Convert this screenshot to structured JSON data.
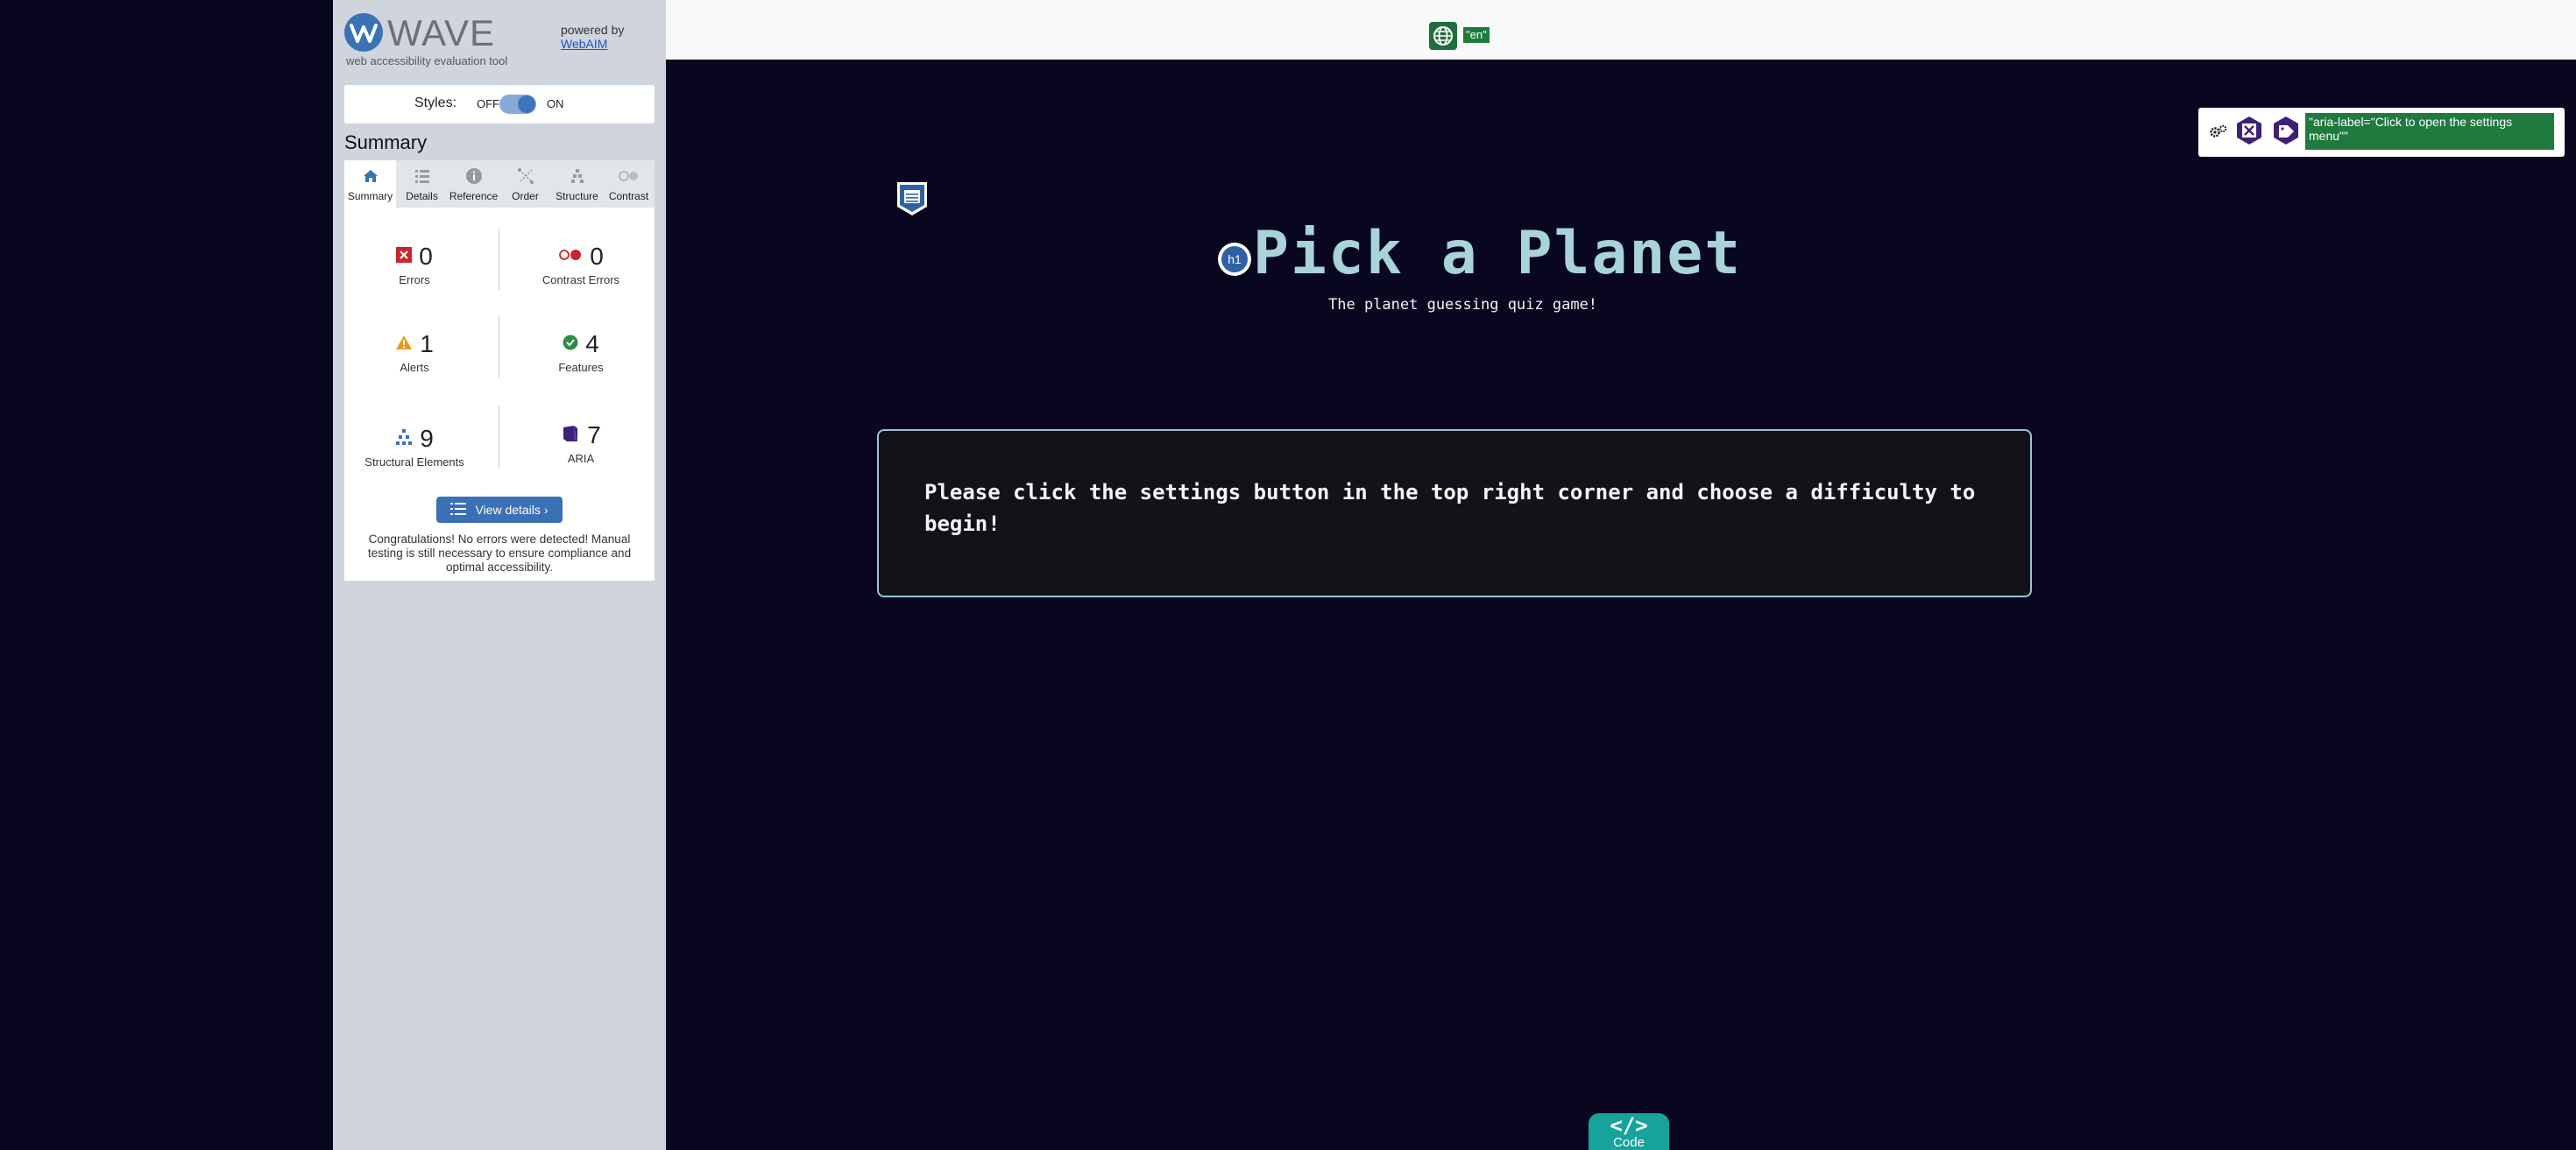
{
  "wave": {
    "logo_text": "WAVE",
    "tagline": "web accessibility evaluation tool",
    "powered_by": "powered by",
    "webaim_link": "WebAIM",
    "styles_label": "Styles:",
    "styles_off": "OFF",
    "styles_on": "ON",
    "summary_heading": "Summary",
    "tabs": [
      {
        "label": "Summary",
        "icon": "home-icon"
      },
      {
        "label": "Details",
        "icon": "list-icon"
      },
      {
        "label": "Reference",
        "icon": "info-icon"
      },
      {
        "label": "Order",
        "icon": "order-icon"
      },
      {
        "label": "Structure",
        "icon": "structure-icon"
      },
      {
        "label": "Contrast",
        "icon": "contrast-icon"
      }
    ],
    "active_tab": "Summary",
    "stats": {
      "errors": {
        "value": "0",
        "label": "Errors"
      },
      "contrast_errors": {
        "value": "0",
        "label": "Contrast Errors"
      },
      "alerts": {
        "value": "1",
        "label": "Alerts"
      },
      "features": {
        "value": "4",
        "label": "Features"
      },
      "structural": {
        "value": "9",
        "label": "Structural Elements"
      },
      "aria": {
        "value": "7",
        "label": "ARIA"
      }
    },
    "view_details_label": "View details ›",
    "congrats": "Congratulations! No errors were detected! Manual testing is still necessary to ensure compliance and optimal accessibility."
  },
  "page": {
    "lang_badge": "\"en\"",
    "aria_label_badge": "\"aria-label=\"Click to open the settings menu\"\"",
    "h1_badge": "h1",
    "title": "Pick a Planet",
    "subtitle": "The planet guessing quiz game!",
    "quiz_message": "Please click the settings button in the top right corner and choose a difficulty to begin!",
    "code_symbol": "</>",
    "code_label": "Code"
  },
  "colors": {
    "page_bg": "#09061f",
    "title": "#a7d3d9",
    "wave_panel": "#d0d5dd",
    "wave_accent": "#3a70b5",
    "code_button": "#17a39b"
  }
}
